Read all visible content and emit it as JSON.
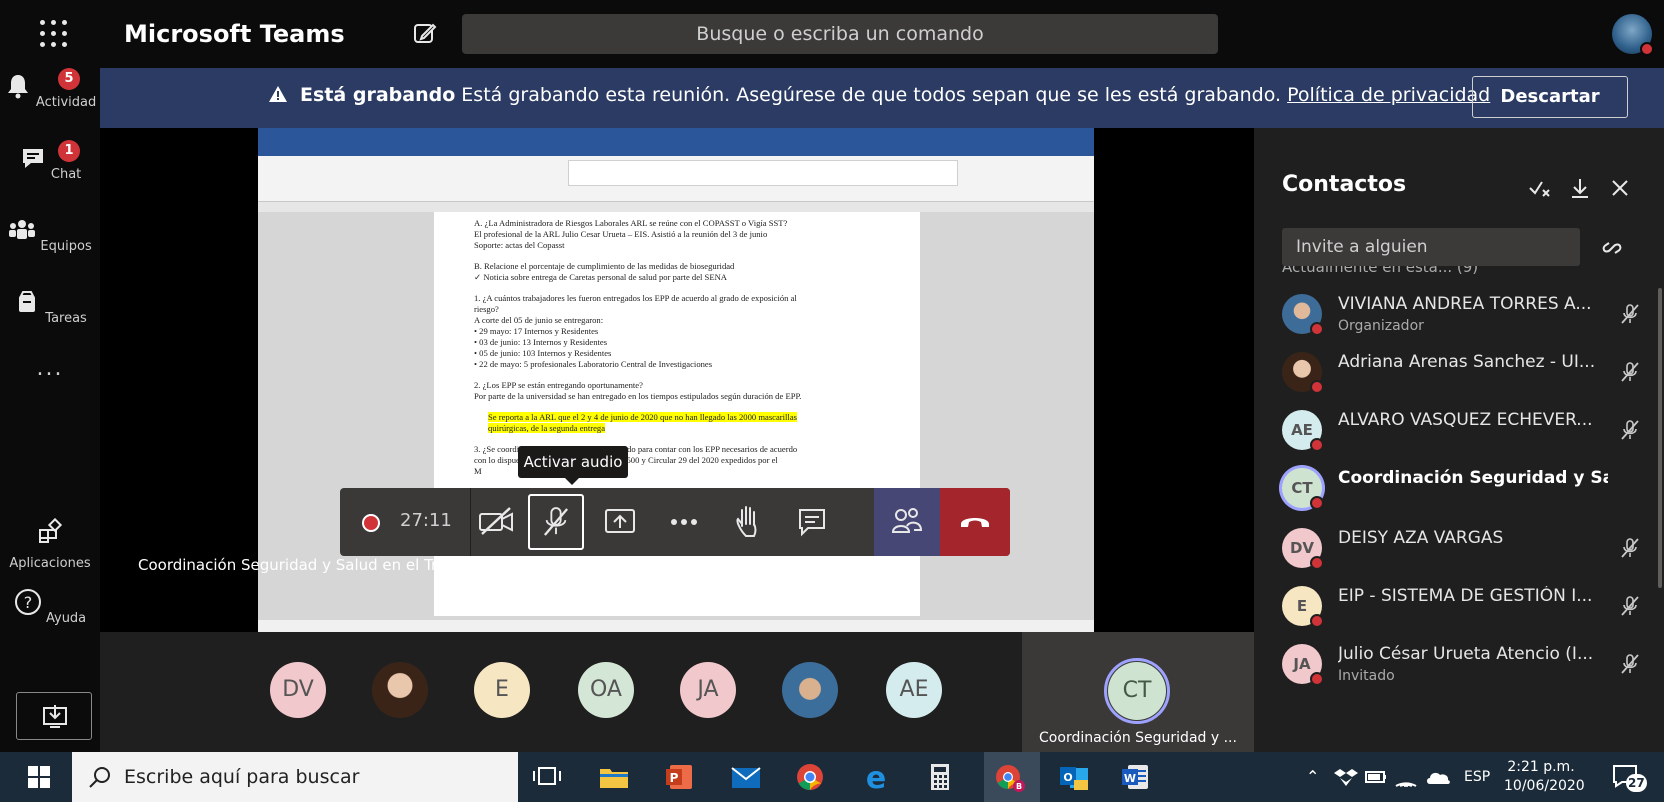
{
  "app": {
    "title": "Microsoft Teams"
  },
  "search": {
    "placeholder": "Busque o escriba un comando"
  },
  "rail": {
    "items": [
      {
        "label": "Actividad",
        "badge": "5"
      },
      {
        "label": "Chat",
        "badge": "1"
      },
      {
        "label": "Equipos"
      },
      {
        "label": "Tareas"
      },
      {
        "label": "..."
      },
      {
        "label": "Aplicaciones"
      },
      {
        "label": "Ayuda"
      }
    ]
  },
  "banner": {
    "title": "Está grabando",
    "message": "Está grabando esta reunión. Asegúrese de que todos sepan que se les está grabando.",
    "link": "Política de privacidad",
    "dismiss": "Descartar"
  },
  "document": {
    "lines": [
      "A.   ¿La Administradora de Riesgos Laborales ARL se reúne con el COPASST o Vigía SST?",
      "        El profesional de la ARL Julio Cesar Urueta – EIS. Asistió a la reunión del 3 de junio",
      "        Soporte: actas del Copasst",
      "",
      "B.   Relacione el porcentaje de cumplimiento de las medidas de bioseguridad",
      "           ✓ Noticia sobre entrega de Caretas personal de salud por parte del SENA",
      "",
      "  1. ¿A cuántos trabajadores les fueron entregados los EPP de acuerdo al grado de exposición al",
      "      riesgo?",
      "      A corte del 05 de junio se entregaron:",
      "        •   29 mayo: 17 Internos y Residentes",
      "        •   03 de junio: 13 Internos y Residentes",
      "        •   05 de junio: 103 Internos y Residentes",
      "        •   22 de mayo: 5 profesionales Laboratorio Central de Investigaciones",
      "",
      "  2. ¿Los EPP se están entregando oportunamente?",
      "      Por parte de la universidad se han entregado en los tiempos estipulados según duración de EPP.",
      ""
    ],
    "highlight": [
      "Se reporta a la ARL que el 2 y 4 de junio de 2020 que no han llegado las 2000 mascarillas",
      "quirúrgicas, de la segunda entrega"
    ],
    "after": [
      "",
      "  3. ¿Se coordinó con la ARL el apoyo requerido para contar con los EPP necesarios de acuerdo",
      "  con lo dispuesto en el Decreto 488, Decreto 500 y Circular 29 del 2020 expedidos por el",
      "  M"
    ]
  },
  "tooltip": "Activar audio",
  "controls": {
    "timer": "27:11"
  },
  "presenter_caption": "Coordinación Seguridad y Salud en el Trabajo",
  "gallery": {
    "tiles": [
      {
        "initials": "DV",
        "bg": "#f1c8cc"
      },
      {
        "initials": "",
        "bg": "#6b4b3a"
      },
      {
        "initials": "E",
        "bg": "#f6e6c2"
      },
      {
        "initials": "OA",
        "bg": "#d4e6d6"
      },
      {
        "initials": "JA",
        "bg": "#f1c8cc"
      },
      {
        "initials": "",
        "bg": "#7a98b5"
      },
      {
        "initials": "AE",
        "bg": "#d5ecee"
      }
    ],
    "self": {
      "initials": "CT",
      "name": "Coordinación Seguridad y ..."
    }
  },
  "contacts": {
    "title": "Contactos",
    "invite_placeholder": "Invite a alguien",
    "section": "Actualmente en esta... (9)",
    "people": [
      {
        "name": "VIVIANA ANDREA TORRES A...",
        "role": "Organizador",
        "initials": "",
        "bg": "#4a76a8"
      },
      {
        "name": "Adriana Arenas Sanchez - UI...",
        "role": "",
        "initials": "",
        "bg": "#6b4b3a"
      },
      {
        "name": "ALVARO VASQUEZ ECHEVER...",
        "role": "",
        "initials": "AE",
        "bg": "#d5ecee"
      },
      {
        "name": "Coordinación Seguridad y Salu...",
        "role": "",
        "initials": "CT",
        "bg": "#cfe3d1"
      },
      {
        "name": "DEISY AZA VARGAS",
        "role": "",
        "initials": "DV",
        "bg": "#f1c8cc"
      },
      {
        "name": "EIP - SISTEMA DE GESTIÓN I...",
        "role": "",
        "initials": "E",
        "bg": "#f6e6c2"
      },
      {
        "name": "Julio César Urueta Atencio (I...",
        "role": "Invitado",
        "initials": "JA",
        "bg": "#f1c8cc"
      }
    ]
  },
  "taskbar": {
    "search_placeholder": "Escribe aquí para buscar",
    "language": "ESP",
    "time": "2:21 p.m.",
    "date": "10/06/2020",
    "notifications": "27"
  }
}
